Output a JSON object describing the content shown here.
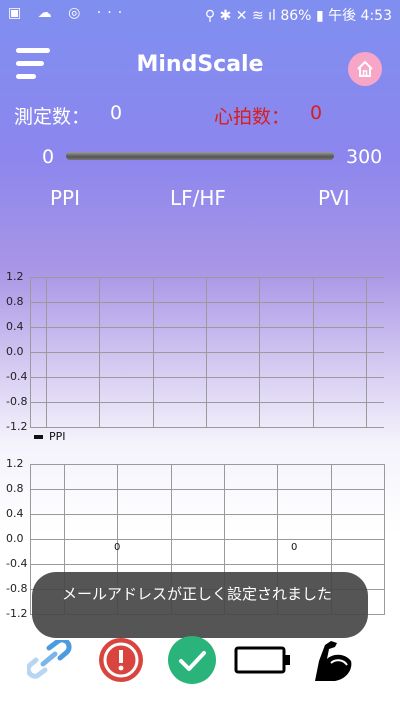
{
  "status_bar": {
    "left_icons": [
      "image-icon",
      "cloud-icon",
      "sync-icon",
      "more-icon"
    ],
    "battery": "86%",
    "time": "午後 4:53"
  },
  "header": {
    "title": "MindScale"
  },
  "counts": {
    "measure_label": "測定数：",
    "measure_value": "0",
    "heart_label": "心拍数：",
    "heart_value": "0"
  },
  "range": {
    "min": "0",
    "max": "300"
  },
  "metrics": [
    "PPI",
    "LF/HF",
    "PVI"
  ],
  "chart_data": [
    {
      "type": "line",
      "yticks": [
        "1.2",
        "0.8",
        "0.4",
        "0.0",
        "-0.4",
        "-0.8",
        "-1.2"
      ],
      "ylim": [
        -1.2,
        1.2
      ],
      "series": [
        {
          "name": "PPI",
          "values": []
        }
      ],
      "grid": true,
      "legend": "bottom-left"
    },
    {
      "type": "line",
      "yticks": [
        "1.2",
        "0.8",
        "0.4",
        "0.0",
        "-0.4",
        "-0.8",
        "-1.2"
      ],
      "ylim": [
        -1.2,
        1.2
      ],
      "data_labels": [
        "0",
        "0"
      ],
      "grid": true
    }
  ],
  "toast": {
    "message": "メールアドレスが正しく設定されました"
  },
  "colors": {
    "heart_red": "#d81e1e",
    "alert_red": "#d9443e",
    "ok_green": "#2ab37a",
    "home_pink": "#f7a6c8"
  }
}
